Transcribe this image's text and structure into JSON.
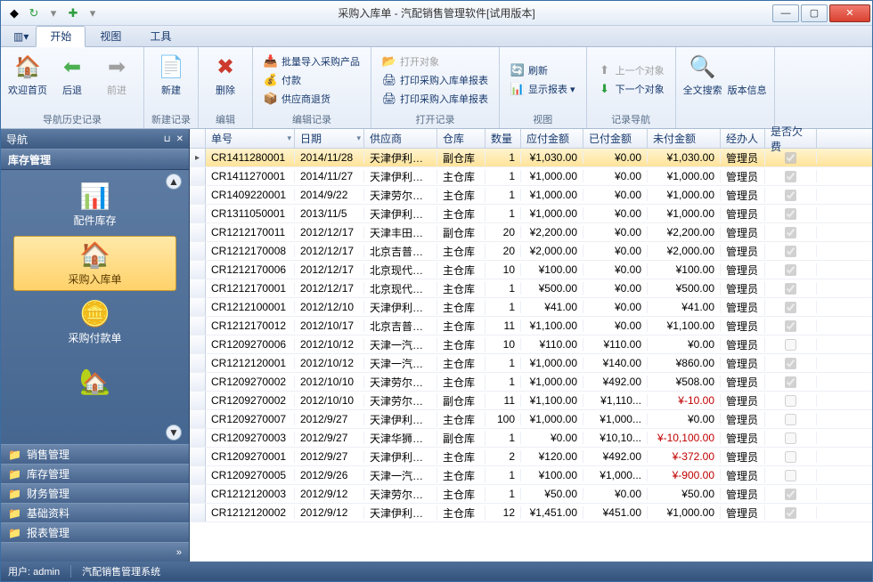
{
  "window": {
    "title": "采购入库单 - 汽配销售管理软件[试用版本]"
  },
  "menubar": {
    "tabs": [
      "开始",
      "视图",
      "工具"
    ],
    "active": 0
  },
  "ribbon": {
    "groups": [
      {
        "label": "导航历史记录",
        "big": [
          {
            "name": "home",
            "icon": "🏠",
            "label": "欢迎首页",
            "enabled": true
          },
          {
            "name": "back",
            "icon": "⬅",
            "label": "后退",
            "enabled": true,
            "color": "#4caf50"
          },
          {
            "name": "forward",
            "icon": "➡",
            "label": "前进",
            "enabled": false
          }
        ]
      },
      {
        "label": "新建记录",
        "big": [
          {
            "name": "new",
            "icon": "📄",
            "label": "新建",
            "enabled": true
          }
        ]
      },
      {
        "label": "编辑",
        "big": [
          {
            "name": "delete",
            "icon": "✖",
            "label": "删除",
            "enabled": true,
            "color": "#cc3b2e"
          }
        ]
      },
      {
        "label": "编辑记录",
        "small": [
          {
            "name": "batch-import",
            "icon": "📥",
            "label": "批量导入采购产品"
          },
          {
            "name": "pay",
            "icon": "💰",
            "label": "付款"
          },
          {
            "name": "supplier-return",
            "icon": "📦",
            "label": "供应商退货"
          }
        ]
      },
      {
        "label": "打开记录",
        "small": [
          {
            "name": "open-object",
            "icon": "📂",
            "label": "打开对象",
            "enabled": false
          },
          {
            "name": "print-single",
            "icon": "🖨",
            "label": "打印采购入库单报表"
          },
          {
            "name": "print-batch",
            "icon": "🖨",
            "label": "打印采购入库单报表"
          }
        ]
      },
      {
        "label": "视图",
        "small": [
          {
            "name": "refresh",
            "icon": "🔄",
            "label": "刷新",
            "color": "#2e9e3f"
          },
          {
            "name": "show-report",
            "icon": "📊",
            "label": "显示报表 ▾"
          }
        ]
      },
      {
        "label": "记录导航",
        "small": [
          {
            "name": "prev",
            "icon": "⬆",
            "label": "上一个对象",
            "enabled": false
          },
          {
            "name": "next",
            "icon": "⬇",
            "label": "下一个对象",
            "color": "#2e9e3f"
          }
        ]
      },
      {
        "label": "",
        "big": [
          {
            "name": "search",
            "icon": "🔍",
            "label": "全文搜索",
            "enabled": true
          },
          {
            "name": "version",
            "icon": "",
            "label": "版本信息",
            "enabled": true
          }
        ]
      }
    ]
  },
  "sidebar": {
    "title": "导航",
    "header": "库存管理",
    "tiles": [
      {
        "name": "parts-inventory",
        "icon": "📊",
        "label": "配件库存",
        "active": false
      },
      {
        "name": "purchase-in",
        "icon": "🏠",
        "label": "采购入库单",
        "active": true
      },
      {
        "name": "purchase-pay",
        "icon": "🪙",
        "label": "采购付款单",
        "active": false
      },
      {
        "name": "more",
        "icon": "🏡",
        "label": "",
        "active": false
      }
    ],
    "accordion": [
      "销售管理",
      "库存管理",
      "财务管理",
      "基础资料",
      "报表管理"
    ]
  },
  "grid": {
    "columns": [
      "单号",
      "日期",
      "供应商",
      "仓库",
      "数量",
      "应付金额",
      "已付金额",
      "未付金额",
      "经办人",
      "是否欠费"
    ],
    "rows": [
      {
        "no": "CR1411280001",
        "date": "2014/11/28",
        "supplier": "天津伊利萨尔...",
        "wh": "副仓库",
        "qty": "1",
        "due": "¥1,030.00",
        "paid": "¥0.00",
        "unpaid": "¥1,030.00",
        "op": "管理员",
        "owe": true,
        "sel": true
      },
      {
        "no": "CR1411270001",
        "date": "2014/11/27",
        "supplier": "天津伊利萨尔...",
        "wh": "主仓库",
        "qty": "1",
        "due": "¥1,000.00",
        "paid": "¥0.00",
        "unpaid": "¥1,000.00",
        "op": "管理员",
        "owe": true
      },
      {
        "no": "CR1409220001",
        "date": "2014/9/22",
        "supplier": "天津劳尔工业...",
        "wh": "主仓库",
        "qty": "1",
        "due": "¥1,000.00",
        "paid": "¥0.00",
        "unpaid": "¥1,000.00",
        "op": "管理员",
        "owe": true
      },
      {
        "no": "CR1311050001",
        "date": "2013/11/5",
        "supplier": "天津伊利萨尔...",
        "wh": "主仓库",
        "qty": "1",
        "due": "¥1,000.00",
        "paid": "¥0.00",
        "unpaid": "¥1,000.00",
        "op": "管理员",
        "owe": true
      },
      {
        "no": "CR1212170011",
        "date": "2012/12/17",
        "supplier": "天津丰田纺织...",
        "wh": "副仓库",
        "qty": "20",
        "due": "¥2,200.00",
        "paid": "¥0.00",
        "unpaid": "¥2,200.00",
        "op": "管理员",
        "owe": true
      },
      {
        "no": "CR1212170008",
        "date": "2012/12/17",
        "supplier": "北京吉普汽车...",
        "wh": "主仓库",
        "qty": "20",
        "due": "¥2,000.00",
        "paid": "¥0.00",
        "unpaid": "¥2,000.00",
        "op": "管理员",
        "owe": true
      },
      {
        "no": "CR1212170006",
        "date": "2012/12/17",
        "supplier": "北京现代汽车...",
        "wh": "主仓库",
        "qty": "10",
        "due": "¥100.00",
        "paid": "¥0.00",
        "unpaid": "¥100.00",
        "op": "管理员",
        "owe": true
      },
      {
        "no": "CR1212170001",
        "date": "2012/12/17",
        "supplier": "北京现代汽车...",
        "wh": "主仓库",
        "qty": "1",
        "due": "¥500.00",
        "paid": "¥0.00",
        "unpaid": "¥500.00",
        "op": "管理员",
        "owe": true
      },
      {
        "no": "CR1212100001",
        "date": "2012/12/10",
        "supplier": "天津伊利萨尔...",
        "wh": "主仓库",
        "qty": "1",
        "due": "¥41.00",
        "paid": "¥0.00",
        "unpaid": "¥41.00",
        "op": "管理员",
        "owe": true
      },
      {
        "no": "CR1212170012",
        "date": "2012/10/17",
        "supplier": "北京吉普汽车...",
        "wh": "主仓库",
        "qty": "11",
        "due": "¥1,100.00",
        "paid": "¥0.00",
        "unpaid": "¥1,100.00",
        "op": "管理员",
        "owe": true
      },
      {
        "no": "CR1209270006",
        "date": "2012/10/12",
        "supplier": "天津一汽丰田...",
        "wh": "主仓库",
        "qty": "10",
        "due": "¥110.00",
        "paid": "¥110.00",
        "unpaid": "¥0.00",
        "op": "管理员",
        "owe": false
      },
      {
        "no": "CR1212120001",
        "date": "2012/10/12",
        "supplier": "天津一汽丰田...",
        "wh": "主仓库",
        "qty": "1",
        "due": "¥1,000.00",
        "paid": "¥140.00",
        "unpaid": "¥860.00",
        "op": "管理员",
        "owe": true
      },
      {
        "no": "CR1209270002",
        "date": "2012/10/10",
        "supplier": "天津劳尔工业...",
        "wh": "主仓库",
        "qty": "1",
        "due": "¥1,000.00",
        "paid": "¥492.00",
        "unpaid": "¥508.00",
        "op": "管理员",
        "owe": true
      },
      {
        "no": "CR1209270002",
        "date": "2012/10/10",
        "supplier": "天津劳尔工业...",
        "wh": "副仓库",
        "qty": "11",
        "due": "¥1,100.00",
        "paid": "¥1,110...",
        "unpaid": "¥-10.00",
        "op": "管理员",
        "owe": false
      },
      {
        "no": "CR1209270007",
        "date": "2012/9/27",
        "supplier": "天津伊利萨尔...",
        "wh": "主仓库",
        "qty": "100",
        "due": "¥1,000.00",
        "paid": "¥1,000...",
        "unpaid": "¥0.00",
        "op": "管理员",
        "owe": false
      },
      {
        "no": "CR1209270003",
        "date": "2012/9/27",
        "supplier": "天津华狮汽车...",
        "wh": "副仓库",
        "qty": "1",
        "due": "¥0.00",
        "paid": "¥10,10...",
        "unpaid": "¥-10,100.00",
        "op": "管理员",
        "owe": false
      },
      {
        "no": "CR1209270001",
        "date": "2012/9/27",
        "supplier": "天津伊利萨尔...",
        "wh": "主仓库",
        "qty": "2",
        "due": "¥120.00",
        "paid": "¥492.00",
        "unpaid": "¥-372.00",
        "op": "管理员",
        "owe": false
      },
      {
        "no": "CR1209270005",
        "date": "2012/9/26",
        "supplier": "天津一汽丰田...",
        "wh": "主仓库",
        "qty": "1",
        "due": "¥100.00",
        "paid": "¥1,000...",
        "unpaid": "¥-900.00",
        "op": "管理员",
        "owe": false
      },
      {
        "no": "CR1212120003",
        "date": "2012/9/12",
        "supplier": "天津劳尔工业...",
        "wh": "主仓库",
        "qty": "1",
        "due": "¥50.00",
        "paid": "¥0.00",
        "unpaid": "¥50.00",
        "op": "管理员",
        "owe": true
      },
      {
        "no": "CR1212120002",
        "date": "2012/9/12",
        "supplier": "天津伊利萨尔...",
        "wh": "主仓库",
        "qty": "12",
        "due": "¥1,451.00",
        "paid": "¥451.00",
        "unpaid": "¥1,000.00",
        "op": "管理员",
        "owe": true
      }
    ]
  },
  "statusbar": {
    "user_label": "用户:",
    "user": "admin",
    "app": "汽配销售管理系统"
  }
}
